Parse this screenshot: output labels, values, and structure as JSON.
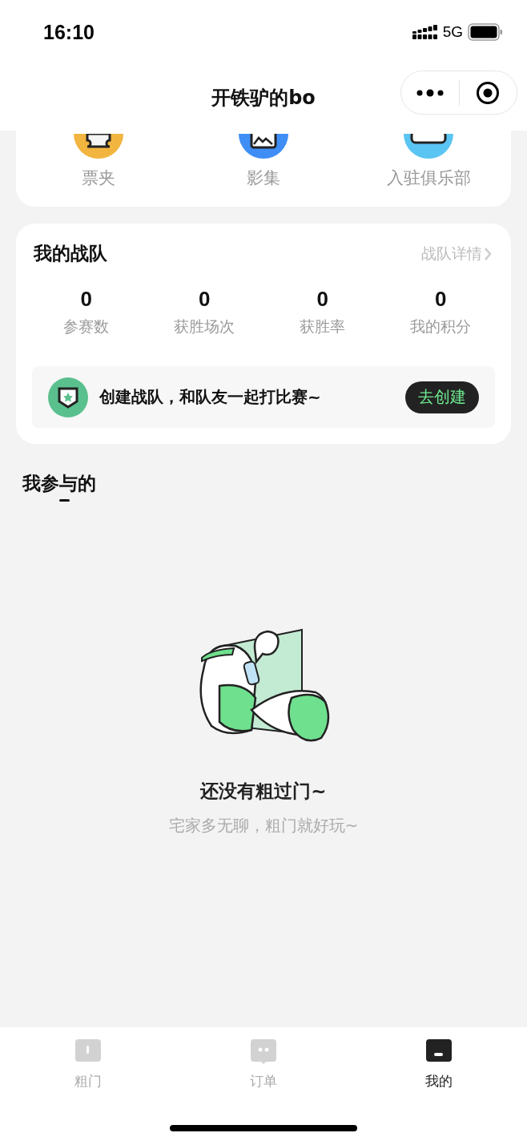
{
  "status_bar": {
    "time": "16:10",
    "network": "5G"
  },
  "nav": {
    "title": "开铁驴的bo"
  },
  "shortcuts": [
    {
      "label": "票夹",
      "color": "#f2b53f",
      "kind": "ticket"
    },
    {
      "label": "影集",
      "color": "#3f8ef5",
      "kind": "album"
    },
    {
      "label": "入驻俱乐部",
      "color": "#5ac4f2",
      "kind": "club"
    }
  ],
  "team": {
    "title": "我的战队",
    "detail_link": "战队详情",
    "stats": [
      {
        "value": "0",
        "label": "参赛数"
      },
      {
        "value": "0",
        "label": "获胜场次"
      },
      {
        "value": "0",
        "label": "获胜率"
      },
      {
        "value": "0",
        "label": "我的积分"
      }
    ],
    "banner": {
      "text": "创建战队，和队友一起打比赛~",
      "button": "去创建"
    }
  },
  "section": {
    "title": "我参与的"
  },
  "empty": {
    "title": "还没有粗过门~",
    "subtitle": "宅家多无聊，粗门就好玩~"
  },
  "tab_bar": [
    {
      "label": "粗门",
      "kind": "home",
      "selected": false
    },
    {
      "label": "订单",
      "kind": "chat",
      "selected": false
    },
    {
      "label": "我的",
      "kind": "me",
      "selected": true
    }
  ]
}
